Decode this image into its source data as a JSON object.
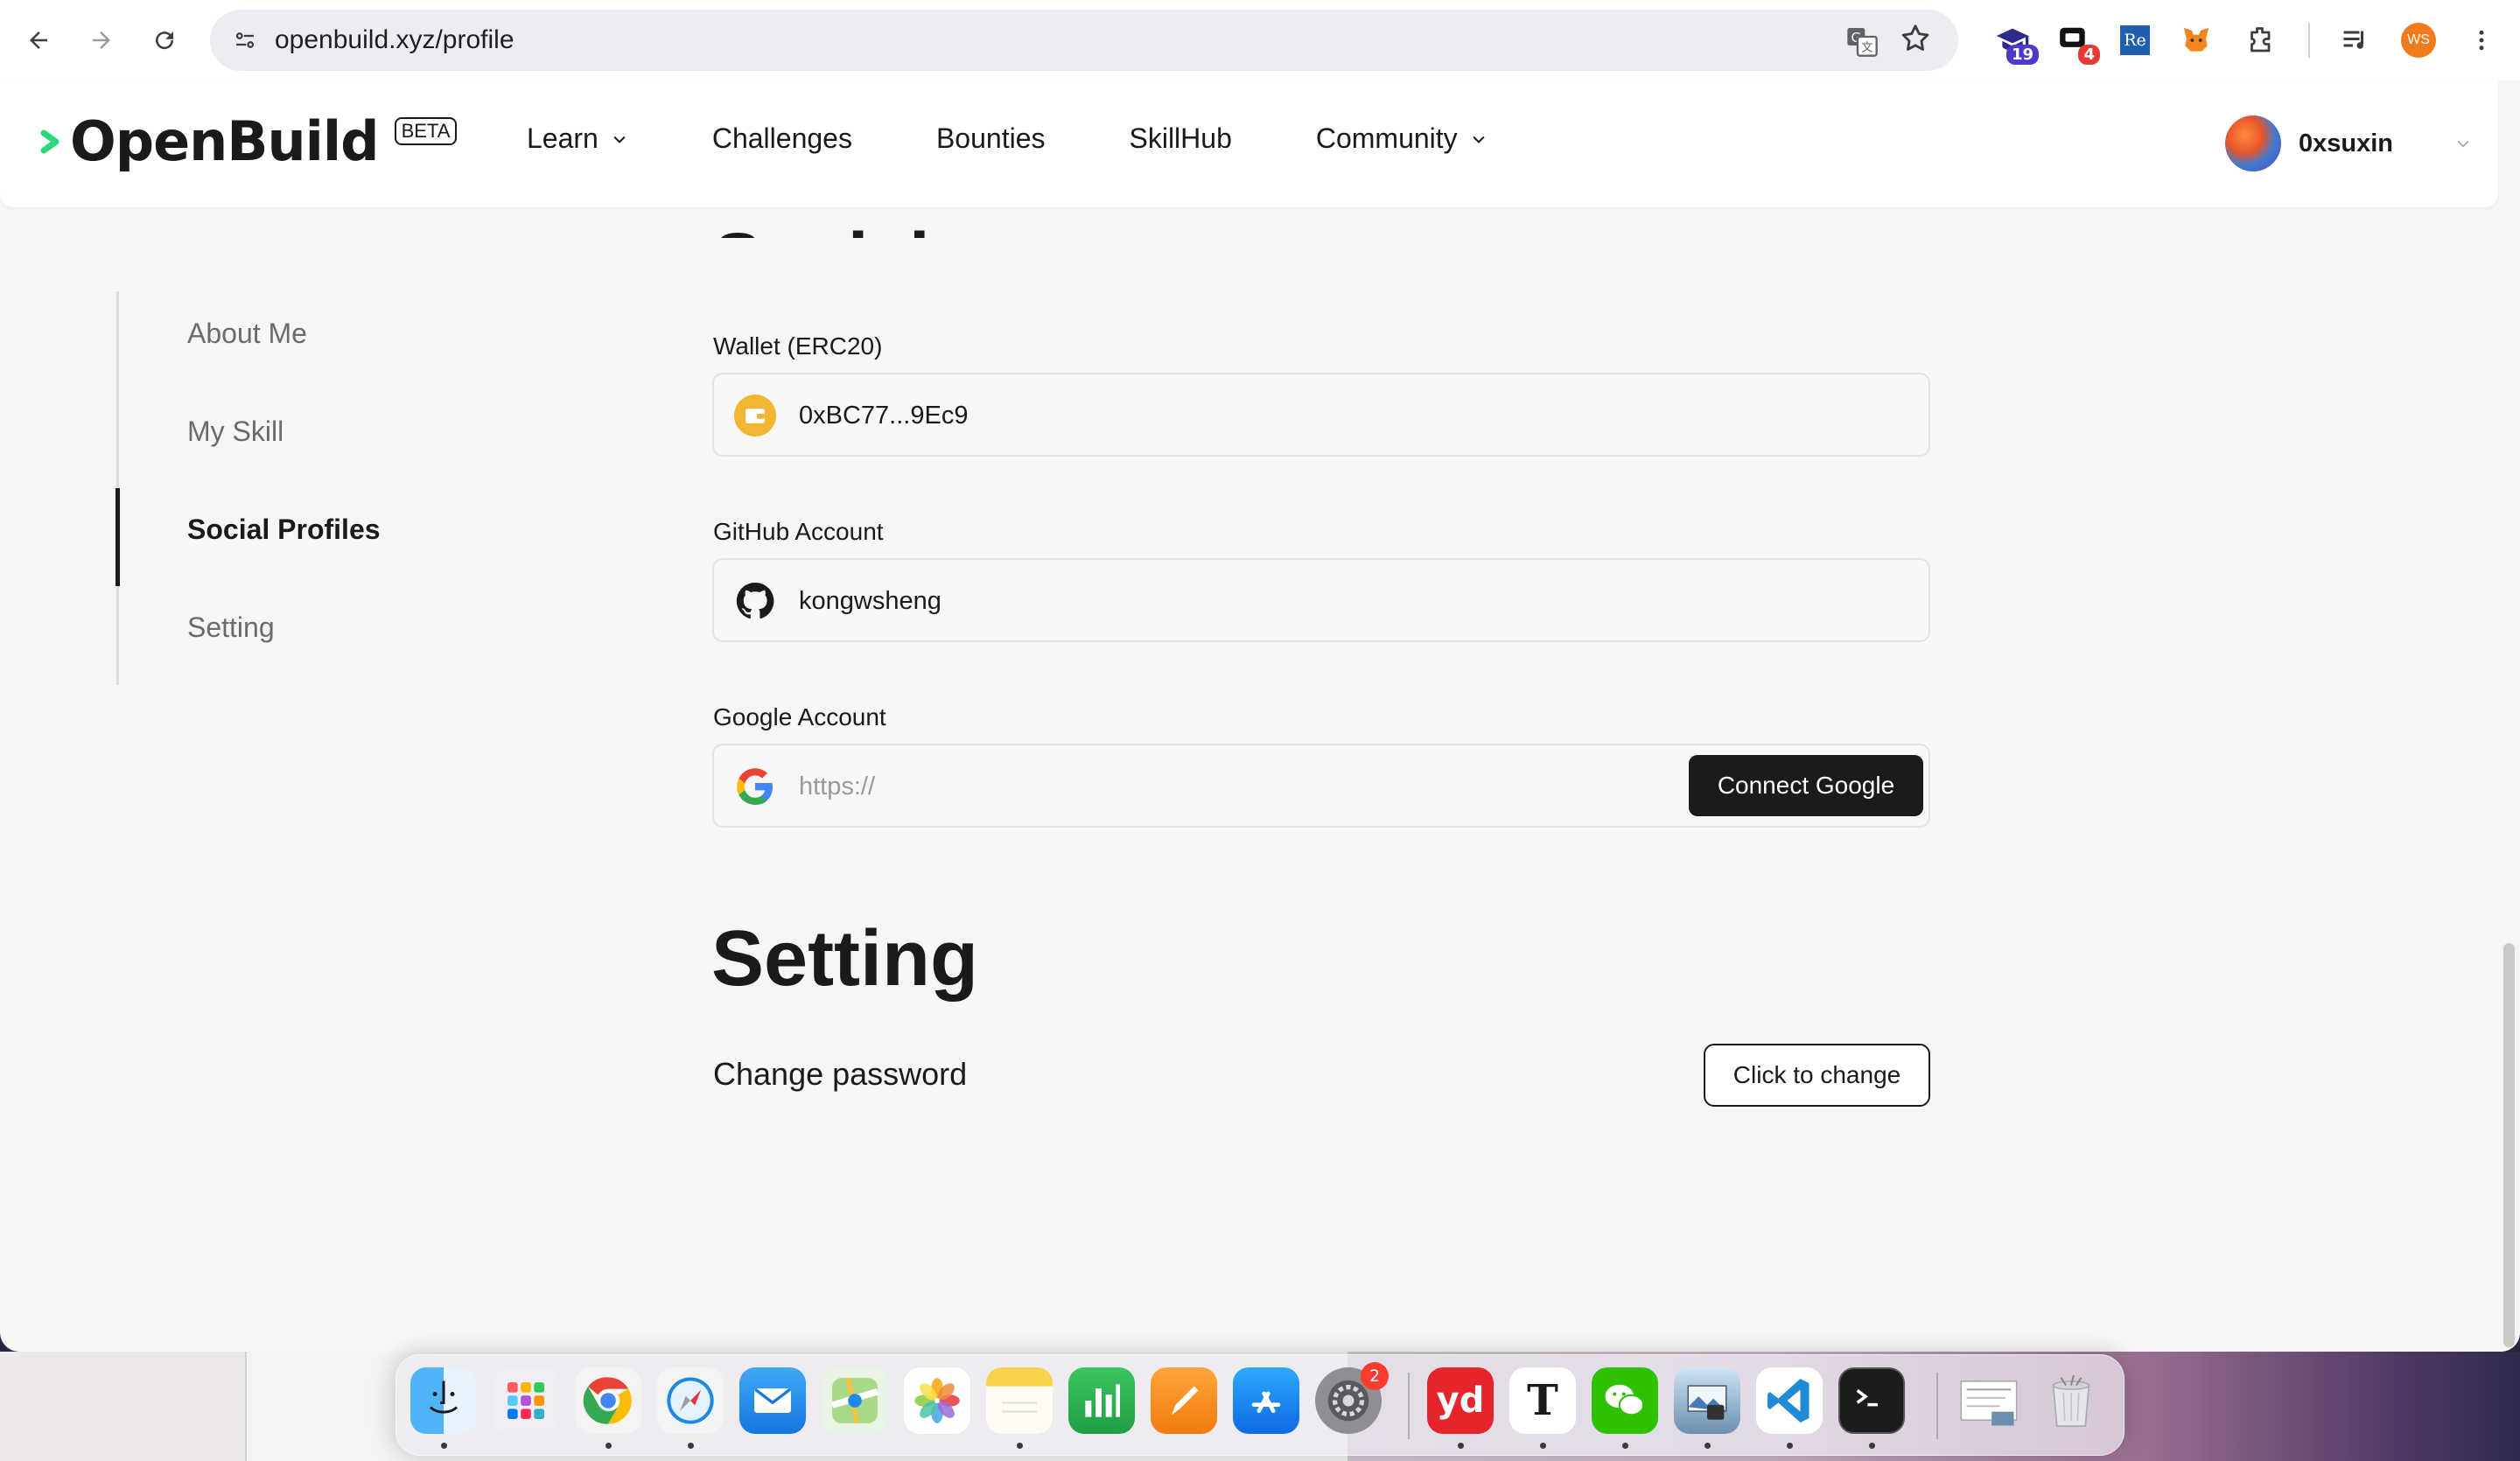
{
  "browser": {
    "url": "openbuild.xyz/profile",
    "extensions": [
      {
        "name": "graduation-cap-extension",
        "badge": "19",
        "badge_color": "#4b3bc9"
      },
      {
        "name": "chat-extension",
        "badge": "4",
        "badge_color": "#e53935"
      },
      {
        "name": "re-extension",
        "label": "Re"
      },
      {
        "name": "metamask-extension"
      },
      {
        "name": "puzzle-extensions"
      },
      {
        "name": "media-controls"
      },
      {
        "name": "profile",
        "label": "WS"
      },
      {
        "name": "menu"
      }
    ]
  },
  "site": {
    "logo_text": "OpenBuild",
    "beta_label": "BETA",
    "nav": [
      {
        "label": "Learn",
        "has_dropdown": true
      },
      {
        "label": "Challenges",
        "has_dropdown": false
      },
      {
        "label": "Bounties",
        "has_dropdown": false
      },
      {
        "label": "SkillHub",
        "has_dropdown": false
      },
      {
        "label": "Community",
        "has_dropdown": true
      }
    ],
    "user": {
      "name": "0xsuxin"
    }
  },
  "sidebar": {
    "items": [
      {
        "label": "About Me",
        "active": false
      },
      {
        "label": "My Skill",
        "active": false
      },
      {
        "label": "Social Profiles",
        "active": true
      },
      {
        "label": "Setting",
        "active": false
      }
    ]
  },
  "social_profiles": {
    "heading": "Social Profiles",
    "wallet": {
      "label": "Wallet (ERC20)",
      "value": "0xBC77...9Ec9"
    },
    "github": {
      "label": "GitHub Account",
      "value": "kongwsheng"
    },
    "google": {
      "label": "Google Account",
      "placeholder": "https://",
      "button": "Connect Google"
    }
  },
  "setting": {
    "title": "Setting",
    "change_password_label": "Change password",
    "change_button": "Click to change"
  },
  "dock": {
    "apps": [
      "Finder",
      "Launchpad",
      "Chrome",
      "Safari",
      "Mail",
      "Maps",
      "Photos",
      "Notes",
      "Numbers",
      "Pages",
      "App Store",
      "System Settings",
      "Youdao",
      "Typora",
      "WeChat",
      "Preview",
      "VS Code",
      "Terminal",
      "Downloads",
      "Trash"
    ],
    "system_settings_badge": "2",
    "youdao_label": "yd",
    "typora_label": "T"
  },
  "colors": {
    "accent_dark": "#1b1b1b",
    "logo_green": "#2bd97b",
    "wallet_yellow": "#f2b632"
  }
}
